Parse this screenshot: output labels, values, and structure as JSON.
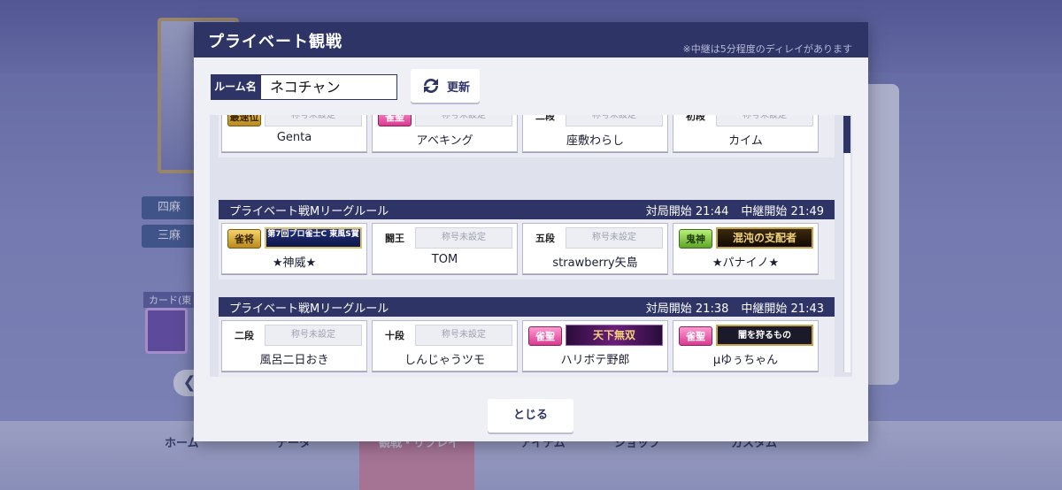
{
  "background": {
    "mode_badges": [
      "四麻",
      "三麻"
    ],
    "card_label": "カード(東",
    "nav_items": [
      "ホーム",
      "データ",
      "観戦・リプレイ",
      "アイテム",
      "ショップ",
      "カスタム"
    ]
  },
  "modal": {
    "title": "プライベート観戦",
    "note": "※中継は5分程度のディレイがあります",
    "room_label": "ルーム名",
    "room_value": "ネコチャン",
    "refresh_label": "更新",
    "close_label": "とじる"
  },
  "title_placeholder": "称号未設定",
  "matches": [
    {
      "rule": "",
      "start_label": "",
      "start_time": "",
      "relay_label": "",
      "relay_time": "",
      "players": [
        {
          "badge": "最速位",
          "badge_style": "gold",
          "title": "称号未設定",
          "name": "Genta"
        },
        {
          "badge": "雀聖",
          "badge_style": "pink",
          "title": "称号未設定",
          "name": "アベキング"
        },
        {
          "badge": "二段",
          "badge_style": "rank",
          "title": "称号未設定",
          "name": "座敷わらし"
        },
        {
          "badge": "初段",
          "badge_style": "rank",
          "title": "称号未設定",
          "name": "カイム"
        }
      ]
    },
    {
      "rule": "プライベート戦Mリーグルール",
      "start_label": "対局開始",
      "start_time": "21:44",
      "relay_label": "中継開始",
      "relay_time": "21:49",
      "players": [
        {
          "badge": "雀将",
          "badge_style": "gold",
          "title": "第7回プロ雀士C 東風S賞",
          "name": "★神威★"
        },
        {
          "badge": "闘王",
          "badge_style": "rank",
          "title": "称号未設定",
          "name": "TOM"
        },
        {
          "badge": "五段",
          "badge_style": "rank",
          "title": "称号未設定",
          "name": "strawberry矢島"
        },
        {
          "badge": "鬼神",
          "badge_style": "green",
          "title": "混沌の支配者",
          "name": "★パナイノ★"
        }
      ]
    },
    {
      "rule": "プライベート戦Mリーグルール",
      "start_label": "対局開始",
      "start_time": "21:38",
      "relay_label": "中継開始",
      "relay_time": "21:43",
      "players": [
        {
          "badge": "二段",
          "badge_style": "rank",
          "title": "称号未設定",
          "name": "風呂二日おき"
        },
        {
          "badge": "十段",
          "badge_style": "rank",
          "title": "称号未設定",
          "name": "しんじゃうツモ"
        },
        {
          "badge": "雀聖",
          "badge_style": "pink",
          "title": "天下無双",
          "name": "ハリボテ野郎"
        },
        {
          "badge": "雀聖",
          "badge_style": "pink",
          "title": "闇を狩るもの",
          "name": "μゆぅちゃん"
        }
      ]
    }
  ]
}
